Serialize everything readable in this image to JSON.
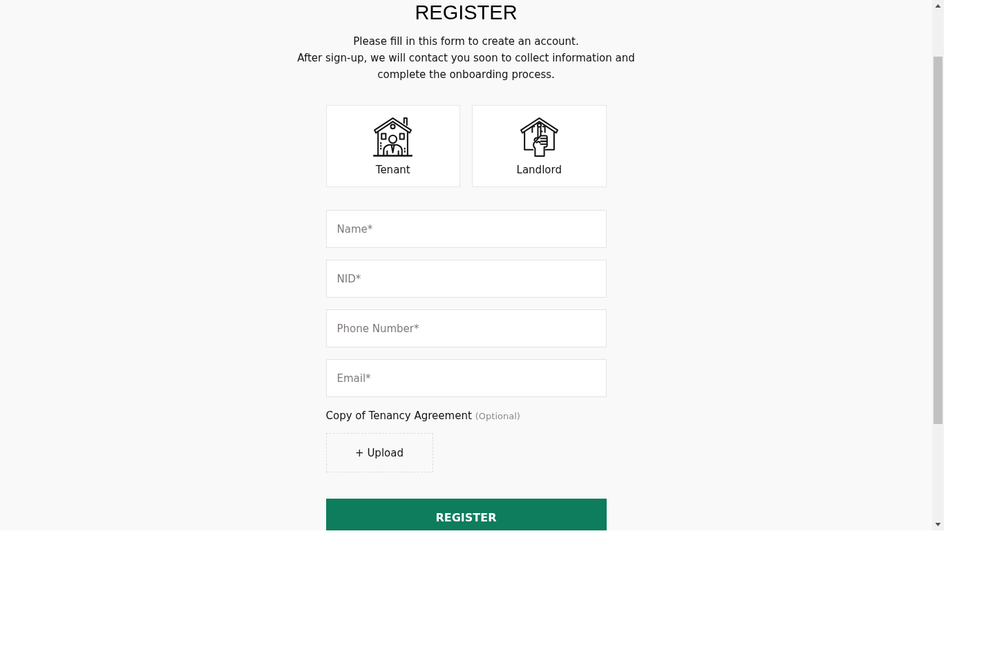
{
  "title": "REGISTER",
  "intro": [
    "Please fill in this form to create an account.",
    "After sign-up, we will contact you soon to collect information and complete the onboarding process."
  ],
  "roles": [
    {
      "kind": "tenant",
      "label": "Tenant",
      "selected": false
    },
    {
      "kind": "landlord",
      "label": "Landlord",
      "selected": false
    }
  ],
  "fields": [
    {
      "placeholder": "Name*"
    },
    {
      "placeholder": "NID*"
    },
    {
      "placeholder": "Phone Number*"
    },
    {
      "placeholder": "Email*"
    }
  ],
  "attachment": {
    "label": "Copy of Tenancy Agreement",
    "hint": "(Optional)",
    "button": "+ Upload"
  },
  "submit": "REGISTER"
}
